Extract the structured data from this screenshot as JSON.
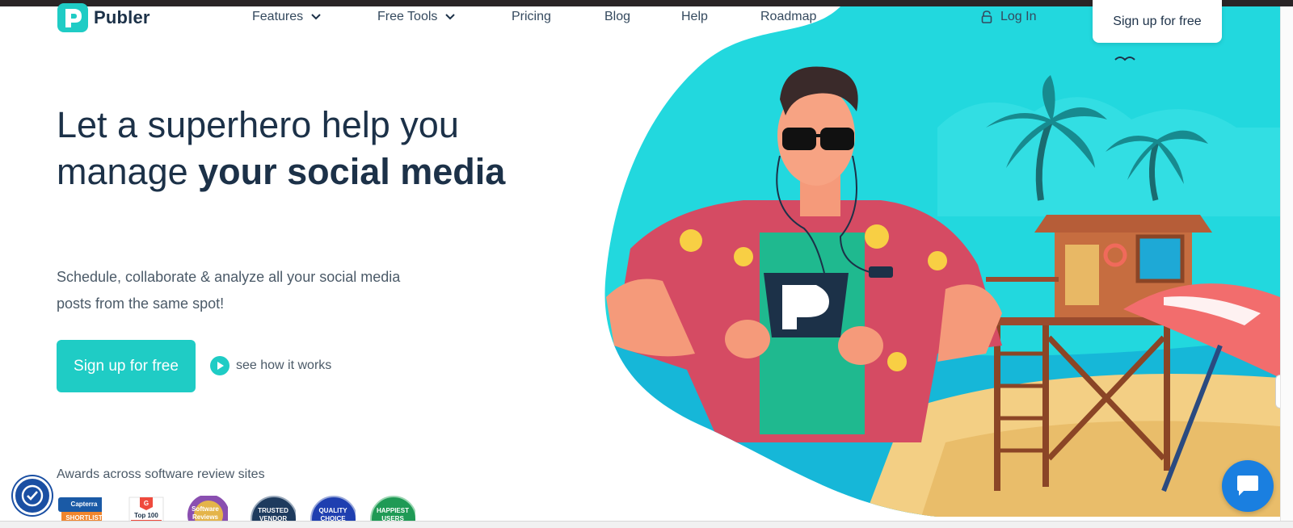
{
  "brand": {
    "name": "Publer",
    "accent": "#1fccc5",
    "text": "#1c3148"
  },
  "nav": {
    "items": [
      {
        "label": "Features",
        "dropdown": true
      },
      {
        "label": "Free Tools",
        "dropdown": true
      },
      {
        "label": "Pricing",
        "dropdown": false
      },
      {
        "label": "Blog",
        "dropdown": false
      },
      {
        "label": "Help",
        "dropdown": false
      },
      {
        "label": "Roadmap",
        "dropdown": false
      }
    ],
    "login_label": "Log In",
    "signup_label": "Sign up for free"
  },
  "hero": {
    "headline_regular": "Let a superhero help you manage",
    "headline_bold": "your social media",
    "subtext": "Schedule, collaborate & analyze all your social media posts from the same spot!",
    "cta_label": "Sign up for free",
    "how_label": "see how it works"
  },
  "awards": {
    "label": "Awards across software review sites",
    "badges": [
      {
        "name": "Capterra",
        "sub": "SHORTLIST"
      },
      {
        "name": "G",
        "sub": "Top 100"
      },
      {
        "name": "Software",
        "sub": "Reviews"
      },
      {
        "name": "TRUSTED",
        "sub": "VENDOR"
      },
      {
        "name": "QUALITY",
        "sub": "CHOICE"
      },
      {
        "name": "HAPPIEST",
        "sub": "USERS"
      }
    ]
  },
  "icons": {
    "chevron": "chevron-down-icon",
    "lock": "lock-icon",
    "play": "play-icon",
    "accessibility": "accessibility-icon",
    "chat": "chat-icon"
  }
}
